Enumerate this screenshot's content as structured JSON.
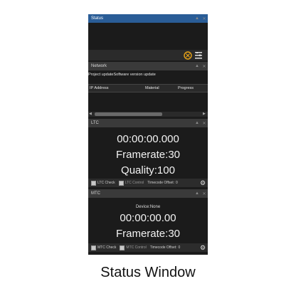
{
  "status": {
    "title": "Status"
  },
  "network": {
    "title": "Network",
    "tabs": [
      "Project update",
      "Software version update"
    ],
    "columns": [
      "IP Address",
      "Material",
      "Progress"
    ]
  },
  "ltc": {
    "title": "LTC",
    "timecode": "00:00:00.000",
    "framerate": "Framerate:30",
    "quality": "Quality:100",
    "ltc_check": "LTC Check",
    "ltc_control": "LTC Control",
    "offset_label": "Timecode Offset:",
    "offset_value": "0"
  },
  "mtc": {
    "title": "MTC",
    "device": "Device:None",
    "timecode": "00:00:00.00",
    "framerate": "Framerate:30",
    "mtc_check": "MTC Check",
    "mtc_control": "MTC Control",
    "offset_label": "Timecode Offset:",
    "offset_value": "0"
  },
  "caption": "Status Window",
  "colors": {
    "accent_blue": "#2a5d97",
    "panel_bg": "#1b1b1b",
    "orange_icon": "#e8a317"
  }
}
